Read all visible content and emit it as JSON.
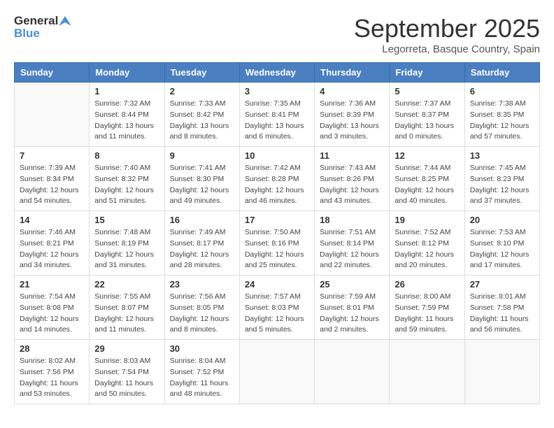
{
  "header": {
    "logo_general": "General",
    "logo_blue": "Blue",
    "month": "September 2025",
    "location": "Legorreta, Basque Country, Spain"
  },
  "weekdays": [
    "Sunday",
    "Monday",
    "Tuesday",
    "Wednesday",
    "Thursday",
    "Friday",
    "Saturday"
  ],
  "weeks": [
    [
      {
        "date": "",
        "info": ""
      },
      {
        "date": "1",
        "info": "Sunrise: 7:32 AM\nSunset: 8:44 PM\nDaylight: 13 hours\nand 11 minutes."
      },
      {
        "date": "2",
        "info": "Sunrise: 7:33 AM\nSunset: 8:42 PM\nDaylight: 13 hours\nand 8 minutes."
      },
      {
        "date": "3",
        "info": "Sunrise: 7:35 AM\nSunset: 8:41 PM\nDaylight: 13 hours\nand 6 minutes."
      },
      {
        "date": "4",
        "info": "Sunrise: 7:36 AM\nSunset: 8:39 PM\nDaylight: 13 hours\nand 3 minutes."
      },
      {
        "date": "5",
        "info": "Sunrise: 7:37 AM\nSunset: 8:37 PM\nDaylight: 13 hours\nand 0 minutes."
      },
      {
        "date": "6",
        "info": "Sunrise: 7:38 AM\nSunset: 8:35 PM\nDaylight: 12 hours\nand 57 minutes."
      }
    ],
    [
      {
        "date": "7",
        "info": "Sunrise: 7:39 AM\nSunset: 8:34 PM\nDaylight: 12 hours\nand 54 minutes."
      },
      {
        "date": "8",
        "info": "Sunrise: 7:40 AM\nSunset: 8:32 PM\nDaylight: 12 hours\nand 51 minutes."
      },
      {
        "date": "9",
        "info": "Sunrise: 7:41 AM\nSunset: 8:30 PM\nDaylight: 12 hours\nand 49 minutes."
      },
      {
        "date": "10",
        "info": "Sunrise: 7:42 AM\nSunset: 8:28 PM\nDaylight: 12 hours\nand 46 minutes."
      },
      {
        "date": "11",
        "info": "Sunrise: 7:43 AM\nSunset: 8:26 PM\nDaylight: 12 hours\nand 43 minutes."
      },
      {
        "date": "12",
        "info": "Sunrise: 7:44 AM\nSunset: 8:25 PM\nDaylight: 12 hours\nand 40 minutes."
      },
      {
        "date": "13",
        "info": "Sunrise: 7:45 AM\nSunset: 8:23 PM\nDaylight: 12 hours\nand 37 minutes."
      }
    ],
    [
      {
        "date": "14",
        "info": "Sunrise: 7:46 AM\nSunset: 8:21 PM\nDaylight: 12 hours\nand 34 minutes."
      },
      {
        "date": "15",
        "info": "Sunrise: 7:48 AM\nSunset: 8:19 PM\nDaylight: 12 hours\nand 31 minutes."
      },
      {
        "date": "16",
        "info": "Sunrise: 7:49 AM\nSunset: 8:17 PM\nDaylight: 12 hours\nand 28 minutes."
      },
      {
        "date": "17",
        "info": "Sunrise: 7:50 AM\nSunset: 8:16 PM\nDaylight: 12 hours\nand 25 minutes."
      },
      {
        "date": "18",
        "info": "Sunrise: 7:51 AM\nSunset: 8:14 PM\nDaylight: 12 hours\nand 22 minutes."
      },
      {
        "date": "19",
        "info": "Sunrise: 7:52 AM\nSunset: 8:12 PM\nDaylight: 12 hours\nand 20 minutes."
      },
      {
        "date": "20",
        "info": "Sunrise: 7:53 AM\nSunset: 8:10 PM\nDaylight: 12 hours\nand 17 minutes."
      }
    ],
    [
      {
        "date": "21",
        "info": "Sunrise: 7:54 AM\nSunset: 8:08 PM\nDaylight: 12 hours\nand 14 minutes."
      },
      {
        "date": "22",
        "info": "Sunrise: 7:55 AM\nSunset: 8:07 PM\nDaylight: 12 hours\nand 11 minutes."
      },
      {
        "date": "23",
        "info": "Sunrise: 7:56 AM\nSunset: 8:05 PM\nDaylight: 12 hours\nand 8 minutes."
      },
      {
        "date": "24",
        "info": "Sunrise: 7:57 AM\nSunset: 8:03 PM\nDaylight: 12 hours\nand 5 minutes."
      },
      {
        "date": "25",
        "info": "Sunrise: 7:59 AM\nSunset: 8:01 PM\nDaylight: 12 hours\nand 2 minutes."
      },
      {
        "date": "26",
        "info": "Sunrise: 8:00 AM\nSunset: 7:59 PM\nDaylight: 11 hours\nand 59 minutes."
      },
      {
        "date": "27",
        "info": "Sunrise: 8:01 AM\nSunset: 7:58 PM\nDaylight: 11 hours\nand 56 minutes."
      }
    ],
    [
      {
        "date": "28",
        "info": "Sunrise: 8:02 AM\nSunset: 7:56 PM\nDaylight: 11 hours\nand 53 minutes."
      },
      {
        "date": "29",
        "info": "Sunrise: 8:03 AM\nSunset: 7:54 PM\nDaylight: 11 hours\nand 50 minutes."
      },
      {
        "date": "30",
        "info": "Sunrise: 8:04 AM\nSunset: 7:52 PM\nDaylight: 11 hours\nand 48 minutes."
      },
      {
        "date": "",
        "info": ""
      },
      {
        "date": "",
        "info": ""
      },
      {
        "date": "",
        "info": ""
      },
      {
        "date": "",
        "info": ""
      }
    ]
  ]
}
